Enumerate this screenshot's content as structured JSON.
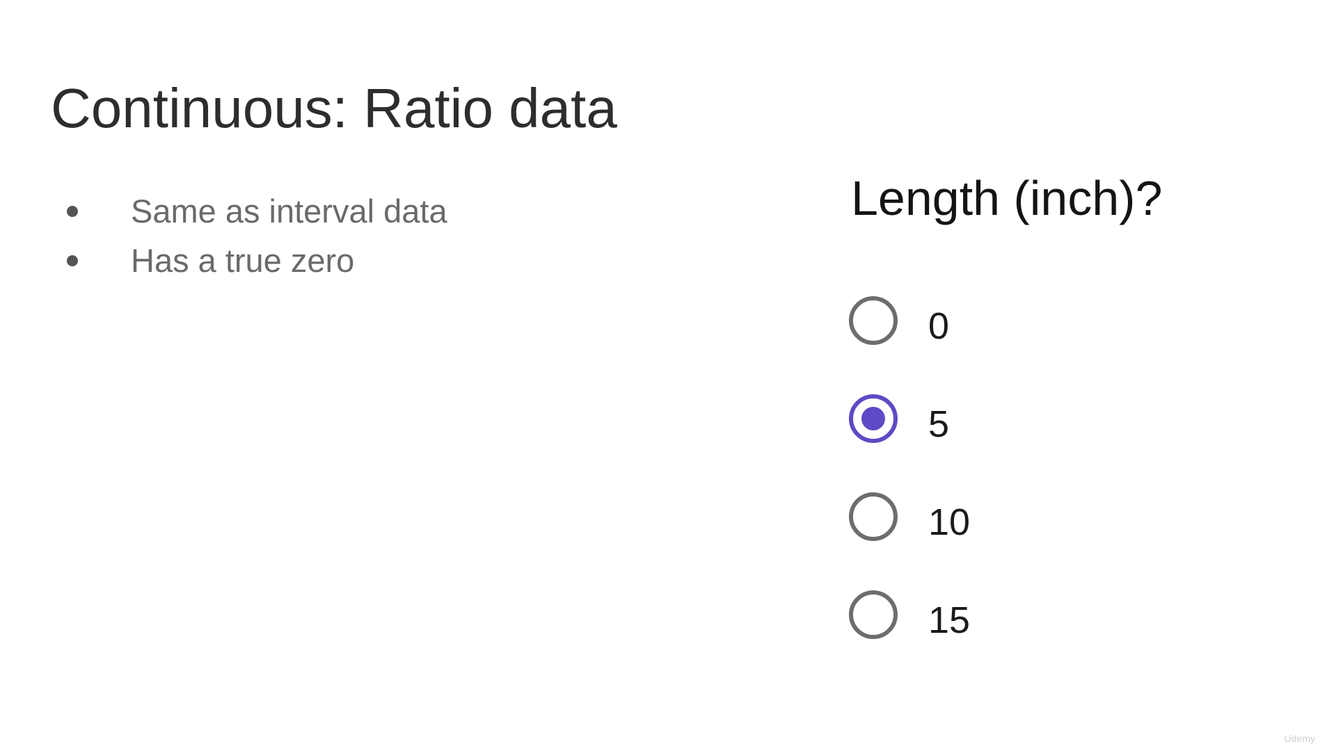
{
  "slide": {
    "title": "Continuous: Ratio data",
    "bullets": [
      "Same as interval data",
      "Has a true zero"
    ]
  },
  "quiz": {
    "question": "Length (inch)?",
    "options": [
      {
        "label": "0",
        "selected": false
      },
      {
        "label": "5",
        "selected": true
      },
      {
        "label": "10",
        "selected": false
      },
      {
        "label": "15",
        "selected": false
      }
    ],
    "accent_color": "#5c4bc4",
    "unselected_color": "#6d6d6d"
  },
  "watermark": {
    "text": "Udemy"
  }
}
